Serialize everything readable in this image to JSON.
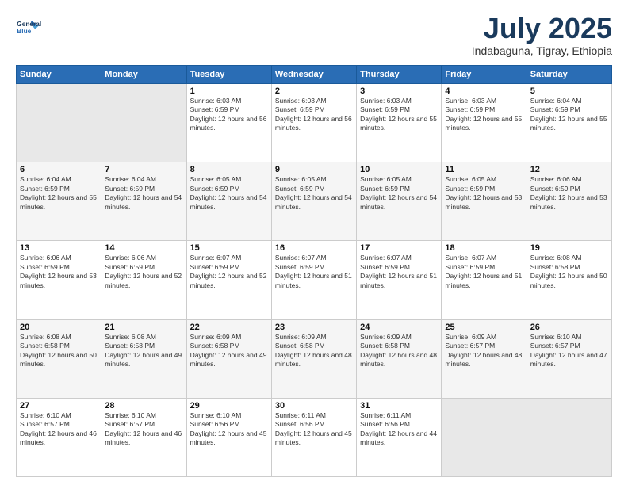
{
  "logo": {
    "line1": "General",
    "line2": "Blue"
  },
  "title": "July 2025",
  "subtitle": "Indabaguna, Tigray, Ethiopia",
  "days_of_week": [
    "Sunday",
    "Monday",
    "Tuesday",
    "Wednesday",
    "Thursday",
    "Friday",
    "Saturday"
  ],
  "weeks": [
    [
      {
        "day": "",
        "info": ""
      },
      {
        "day": "",
        "info": ""
      },
      {
        "day": "1",
        "info": "Sunrise: 6:03 AM\nSunset: 6:59 PM\nDaylight: 12 hours and 56 minutes."
      },
      {
        "day": "2",
        "info": "Sunrise: 6:03 AM\nSunset: 6:59 PM\nDaylight: 12 hours and 56 minutes."
      },
      {
        "day": "3",
        "info": "Sunrise: 6:03 AM\nSunset: 6:59 PM\nDaylight: 12 hours and 55 minutes."
      },
      {
        "day": "4",
        "info": "Sunrise: 6:03 AM\nSunset: 6:59 PM\nDaylight: 12 hours and 55 minutes."
      },
      {
        "day": "5",
        "info": "Sunrise: 6:04 AM\nSunset: 6:59 PM\nDaylight: 12 hours and 55 minutes."
      }
    ],
    [
      {
        "day": "6",
        "info": "Sunrise: 6:04 AM\nSunset: 6:59 PM\nDaylight: 12 hours and 55 minutes."
      },
      {
        "day": "7",
        "info": "Sunrise: 6:04 AM\nSunset: 6:59 PM\nDaylight: 12 hours and 54 minutes."
      },
      {
        "day": "8",
        "info": "Sunrise: 6:05 AM\nSunset: 6:59 PM\nDaylight: 12 hours and 54 minutes."
      },
      {
        "day": "9",
        "info": "Sunrise: 6:05 AM\nSunset: 6:59 PM\nDaylight: 12 hours and 54 minutes."
      },
      {
        "day": "10",
        "info": "Sunrise: 6:05 AM\nSunset: 6:59 PM\nDaylight: 12 hours and 54 minutes."
      },
      {
        "day": "11",
        "info": "Sunrise: 6:05 AM\nSunset: 6:59 PM\nDaylight: 12 hours and 53 minutes."
      },
      {
        "day": "12",
        "info": "Sunrise: 6:06 AM\nSunset: 6:59 PM\nDaylight: 12 hours and 53 minutes."
      }
    ],
    [
      {
        "day": "13",
        "info": "Sunrise: 6:06 AM\nSunset: 6:59 PM\nDaylight: 12 hours and 53 minutes."
      },
      {
        "day": "14",
        "info": "Sunrise: 6:06 AM\nSunset: 6:59 PM\nDaylight: 12 hours and 52 minutes."
      },
      {
        "day": "15",
        "info": "Sunrise: 6:07 AM\nSunset: 6:59 PM\nDaylight: 12 hours and 52 minutes."
      },
      {
        "day": "16",
        "info": "Sunrise: 6:07 AM\nSunset: 6:59 PM\nDaylight: 12 hours and 51 minutes."
      },
      {
        "day": "17",
        "info": "Sunrise: 6:07 AM\nSunset: 6:59 PM\nDaylight: 12 hours and 51 minutes."
      },
      {
        "day": "18",
        "info": "Sunrise: 6:07 AM\nSunset: 6:59 PM\nDaylight: 12 hours and 51 minutes."
      },
      {
        "day": "19",
        "info": "Sunrise: 6:08 AM\nSunset: 6:58 PM\nDaylight: 12 hours and 50 minutes."
      }
    ],
    [
      {
        "day": "20",
        "info": "Sunrise: 6:08 AM\nSunset: 6:58 PM\nDaylight: 12 hours and 50 minutes."
      },
      {
        "day": "21",
        "info": "Sunrise: 6:08 AM\nSunset: 6:58 PM\nDaylight: 12 hours and 49 minutes."
      },
      {
        "day": "22",
        "info": "Sunrise: 6:09 AM\nSunset: 6:58 PM\nDaylight: 12 hours and 49 minutes."
      },
      {
        "day": "23",
        "info": "Sunrise: 6:09 AM\nSunset: 6:58 PM\nDaylight: 12 hours and 48 minutes."
      },
      {
        "day": "24",
        "info": "Sunrise: 6:09 AM\nSunset: 6:58 PM\nDaylight: 12 hours and 48 minutes."
      },
      {
        "day": "25",
        "info": "Sunrise: 6:09 AM\nSunset: 6:57 PM\nDaylight: 12 hours and 48 minutes."
      },
      {
        "day": "26",
        "info": "Sunrise: 6:10 AM\nSunset: 6:57 PM\nDaylight: 12 hours and 47 minutes."
      }
    ],
    [
      {
        "day": "27",
        "info": "Sunrise: 6:10 AM\nSunset: 6:57 PM\nDaylight: 12 hours and 46 minutes."
      },
      {
        "day": "28",
        "info": "Sunrise: 6:10 AM\nSunset: 6:57 PM\nDaylight: 12 hours and 46 minutes."
      },
      {
        "day": "29",
        "info": "Sunrise: 6:10 AM\nSunset: 6:56 PM\nDaylight: 12 hours and 45 minutes."
      },
      {
        "day": "30",
        "info": "Sunrise: 6:11 AM\nSunset: 6:56 PM\nDaylight: 12 hours and 45 minutes."
      },
      {
        "day": "31",
        "info": "Sunrise: 6:11 AM\nSunset: 6:56 PM\nDaylight: 12 hours and 44 minutes."
      },
      {
        "day": "",
        "info": ""
      },
      {
        "day": "",
        "info": ""
      }
    ]
  ]
}
